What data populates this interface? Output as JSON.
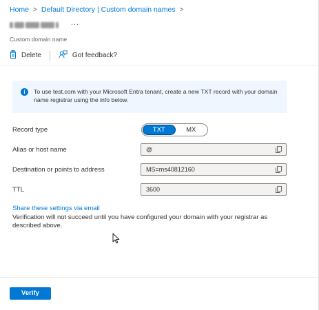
{
  "breadcrumb": {
    "items": [
      "Home",
      "Default Directory | Custom domain names"
    ],
    "separator": ">"
  },
  "header": {
    "more_label": "...",
    "subtitle": "Custom domain name"
  },
  "toolbar": {
    "delete_label": "Delete",
    "feedback_label": "Got feedback?"
  },
  "info": {
    "message": "To use test.com with your Microsoft Entra tenant, create a new TXT record with your domain name registrar using the info below."
  },
  "form": {
    "record_type": {
      "label": "Record type",
      "options": [
        "TXT",
        "MX"
      ],
      "selected": "TXT"
    },
    "alias": {
      "label": "Alias or host name",
      "value": "@"
    },
    "destination": {
      "label": "Destination or points to address",
      "value": "MS=ms40812160"
    },
    "ttl": {
      "label": "TTL",
      "value": "3600"
    }
  },
  "share_link": "Share these settings via email",
  "verification_note": "Verification will not succeed until you have configured your domain with your registrar as described above.",
  "footer": {
    "verify_label": "Verify"
  },
  "colors": {
    "accent": "#0078d4",
    "info_background": "#f0f6ff",
    "field_background": "#f3f2f1"
  }
}
